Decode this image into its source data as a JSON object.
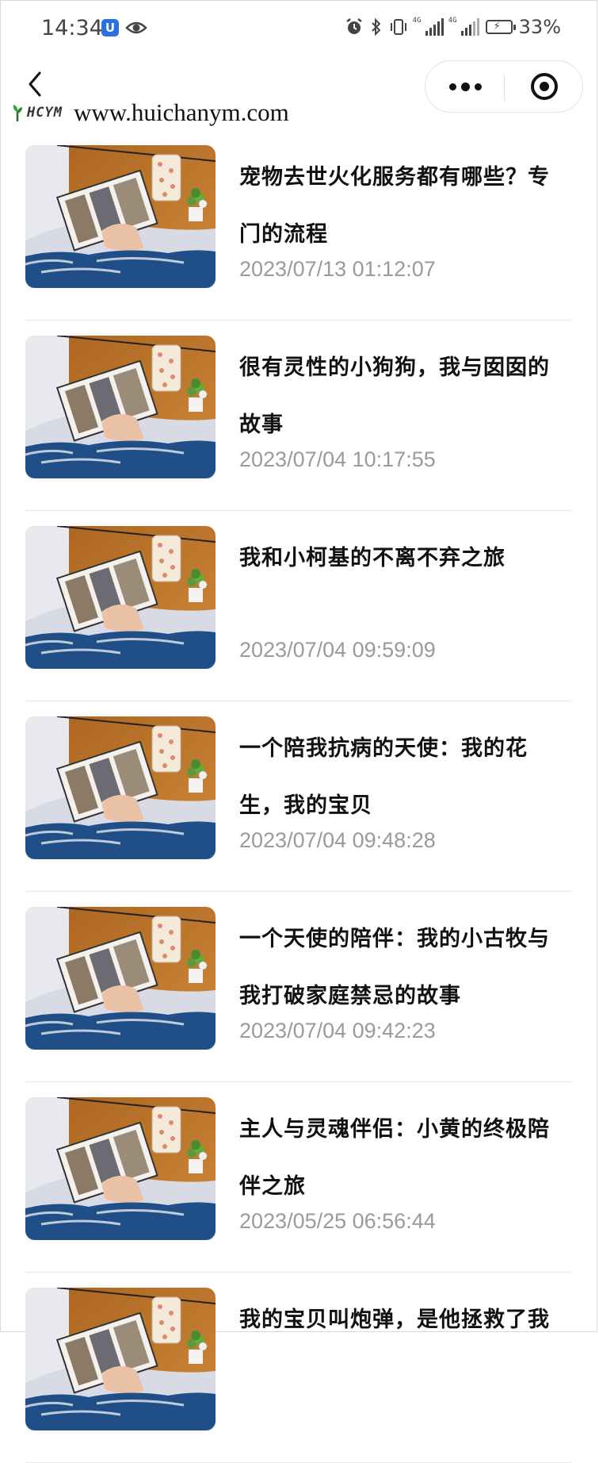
{
  "status_bar": {
    "time": "14:34",
    "app_badge": "U",
    "network_label": "4G",
    "battery": "33%"
  },
  "nav": {
    "back_icon": "chevron-left-icon",
    "more_icon": "more-dots-icon",
    "close_icon": "target-circle-icon"
  },
  "watermark": {
    "logo": "HCYM",
    "url": "www.huichanym.com"
  },
  "articles": [
    {
      "title_line1": "宠物去世火化服务都有哪些？专",
      "title_line2": "门的流程",
      "date": "2023/07/13 01:12:07"
    },
    {
      "title_line1": "很有灵性的小狗狗，我与囡囡的",
      "title_line2": "故事",
      "date": "2023/07/04 10:17:55"
    },
    {
      "title_line1": "我和小柯基的不离不弃之旅",
      "title_line2": "",
      "date": "2023/07/04 09:59:09"
    },
    {
      "title_line1": "一个陪我抗病的天使：我的花",
      "title_line2": "生，我的宝贝",
      "date": "2023/07/04 09:48:28"
    },
    {
      "title_line1": "一个天使的陪伴：我的小古牧与",
      "title_line2": "我打破家庭禁忌的故事",
      "date": "2023/07/04 09:42:23"
    },
    {
      "title_line1": "主人与灵魂伴侣：小黄的终极陪",
      "title_line2": "伴之旅",
      "date": "2023/05/25 06:56:44"
    },
    {
      "title_line1": "我的宝贝叫炮弹，是他拯救了我",
      "title_line2": "",
      "date": ""
    }
  ]
}
